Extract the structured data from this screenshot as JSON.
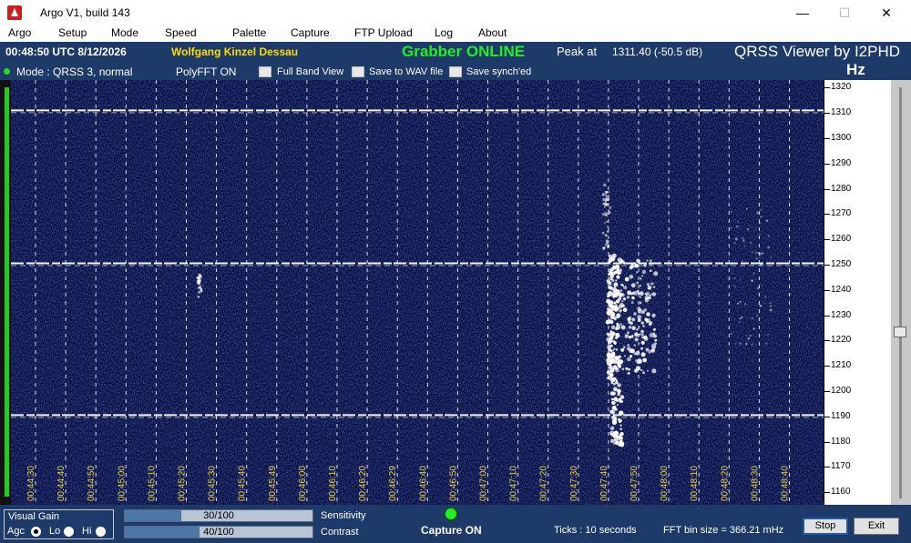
{
  "window": {
    "title": "Argo V1, build 143",
    "controls": {
      "minimize": "—",
      "maximize": "☐",
      "close": "✕"
    }
  },
  "menu": [
    "Argo",
    "Setup",
    "Mode",
    "Speed",
    "Palette",
    "Capture",
    "FTP Upload",
    "Log",
    "About"
  ],
  "header": {
    "utc": "00:48:50 UTC  8/12/2026",
    "station": "Wolfgang Kinzel Dessau",
    "grabber_status": "Grabber ONLINE",
    "peak_label": "Peak at",
    "peak_value": "1311.40 (-50.5 dB)",
    "viewer_title": "QRSS Viewer by I2PHD",
    "unit": "Hz",
    "mode": "Mode : QRSS 3, normal",
    "polyfft": "PolyFFT ON",
    "checkboxes": [
      "Full Band View",
      "Save to WAV file",
      "Save synch'ed"
    ]
  },
  "waterfall": {
    "time_labels": [
      "00:44:30",
      "00:44:40",
      "00:44:50",
      "00:45:00",
      "00:45:10",
      "00:45:20",
      "00:45:30",
      "00:45:40",
      "00:45:49",
      "00:46:00",
      "00:46:10",
      "00:46:20",
      "00:46:29",
      "00:46:40",
      "00:46:50",
      "00:47:00",
      "00:47:10",
      "00:47:20",
      "00:47:30",
      "00:47:40",
      "00:47:50",
      "00:48:00",
      "00:48:10",
      "00:48:20",
      "00:48:30",
      "00:48:40"
    ],
    "freq_labels": [
      "1320",
      "1310",
      "1300",
      "1290",
      "1280",
      "1270",
      "1260",
      "1250",
      "1240",
      "1230",
      "1220",
      "1210",
      "1200",
      "1190",
      "1180",
      "1170",
      "1160"
    ],
    "freq_range_hz": [
      1155,
      1323
    ],
    "carrier_lines_hz": [
      1311,
      1250.5,
      1190.5
    ],
    "colors": {
      "background": "#050c38",
      "signal": "#ffffff",
      "time_label": "#e8d24a",
      "tick_line": "#ffffff"
    }
  },
  "bottom": {
    "visual_gain_title": "Visual Gain",
    "gain_options": [
      "Agc",
      "Lo",
      "Hi"
    ],
    "gain_selected": "Agc",
    "sensitivity": {
      "value": 30,
      "max": 100,
      "text": "30/100",
      "label": "Sensitivity"
    },
    "contrast": {
      "value": 40,
      "max": 100,
      "text": "40/100",
      "label": "Contrast"
    },
    "capture_status": "Capture ON",
    "ticks": "Ticks  : 10 seconds",
    "fft_bin": "FFT bin size = 366.21 mHz",
    "stop_label": "Stop",
    "exit_label": "Exit"
  }
}
